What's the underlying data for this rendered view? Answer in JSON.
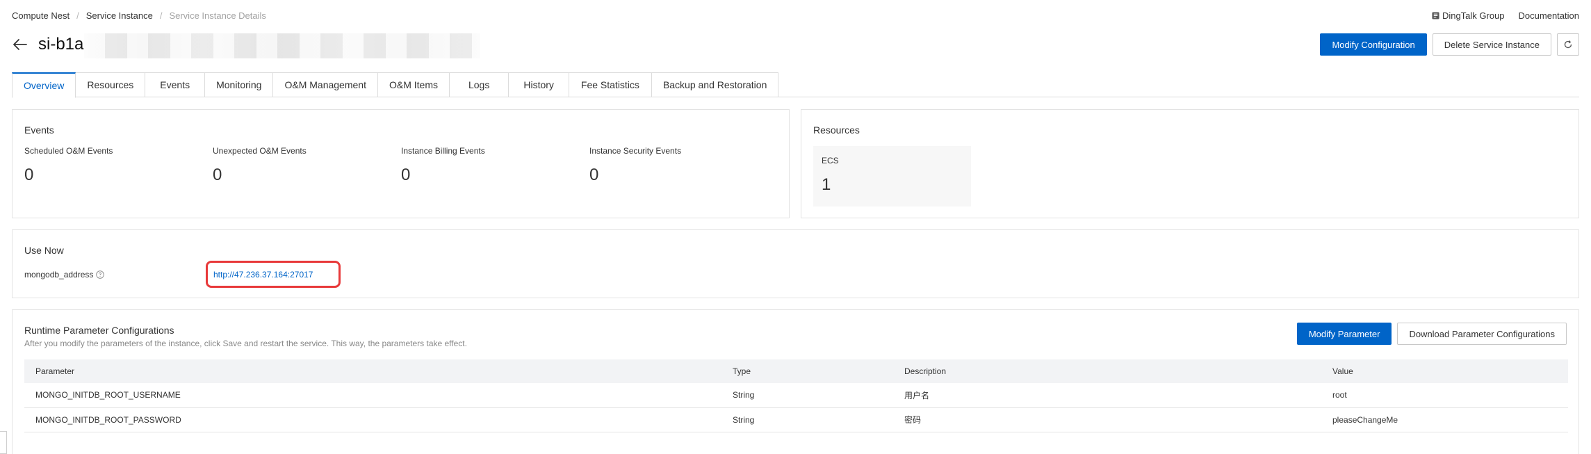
{
  "breadcrumb": {
    "items": [
      "Compute Nest",
      "Service Instance",
      "Service Instance Details"
    ]
  },
  "top_links": {
    "dingtalk": "DingTalk Group",
    "docs": "Documentation"
  },
  "header": {
    "title": "si-b1a",
    "modify_config": "Modify Configuration",
    "delete_instance": "Delete Service Instance"
  },
  "tabs": [
    {
      "label": "Overview",
      "active": true
    },
    {
      "label": "Resources"
    },
    {
      "label": "Events"
    },
    {
      "label": "Monitoring"
    },
    {
      "label": "O&M Management"
    },
    {
      "label": "O&M Items"
    },
    {
      "label": "Logs"
    },
    {
      "label": "History"
    },
    {
      "label": "Fee Statistics"
    },
    {
      "label": "Backup and Restoration"
    }
  ],
  "events": {
    "title": "Events",
    "stats": [
      {
        "label": "Scheduled O&M Events",
        "value": "0"
      },
      {
        "label": "Unexpected O&M Events",
        "value": "0"
      },
      {
        "label": "Instance Billing Events",
        "value": "0"
      },
      {
        "label": "Instance Security Events",
        "value": "0"
      }
    ]
  },
  "resources": {
    "title": "Resources",
    "ecs_label": "ECS",
    "ecs_count": "1"
  },
  "use_now": {
    "title": "Use Now",
    "label": "mongodb_address",
    "address": "http://47.236.37.164:27017",
    "highlight_color": "#e8393a"
  },
  "params": {
    "title": "Runtime Parameter Configurations",
    "subtitle": "After you modify the parameters of the instance, click Save and restart the service. This way, the parameters take effect.",
    "modify_btn": "Modify Parameter",
    "download_btn": "Download Parameter Configurations",
    "columns": [
      "Parameter",
      "Type",
      "Description",
      "Value"
    ],
    "rows": [
      [
        "MONGO_INITDB_ROOT_USERNAME",
        "String",
        "用户名",
        "root"
      ],
      [
        "MONGO_INITDB_ROOT_PASSWORD",
        "String",
        "密码",
        "pleaseChangeMe"
      ]
    ]
  },
  "colors": {
    "primary": "#0064c8",
    "border": "#e3e3e3",
    "table_header_bg": "#f2f3f5"
  }
}
